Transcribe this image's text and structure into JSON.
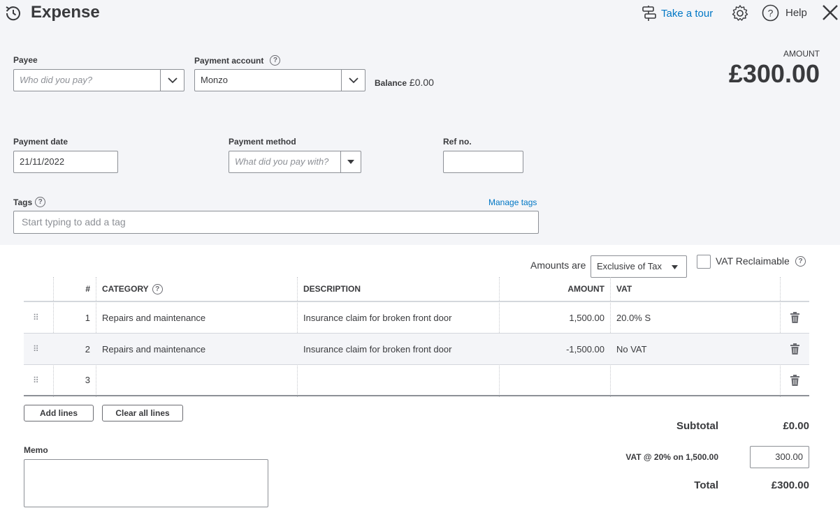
{
  "header": {
    "title": "Expense",
    "tour_label": "Take a tour",
    "help_label": "Help"
  },
  "payee": {
    "label": "Payee",
    "placeholder": "Who did you pay?"
  },
  "payment_account": {
    "label": "Payment account",
    "value": "Monzo",
    "balance_label": "Balance",
    "balance_value": "£0.00"
  },
  "amount": {
    "label": "AMOUNT",
    "value": "£300.00"
  },
  "payment_date": {
    "label": "Payment date",
    "value": "21/11/2022"
  },
  "payment_method": {
    "label": "Payment method",
    "placeholder": "What did you pay with?"
  },
  "ref_no": {
    "label": "Ref no.",
    "value": ""
  },
  "tags": {
    "label": "Tags",
    "manage_label": "Manage tags",
    "placeholder": "Start typing to add a tag"
  },
  "tax_options": {
    "amounts_are_label": "Amounts are",
    "amounts_are_value": "Exclusive of Tax",
    "vat_reclaimable_label": "VAT Reclaimable"
  },
  "table": {
    "headers": {
      "num": "#",
      "category": "CATEGORY",
      "description": "DESCRIPTION",
      "amount": "AMOUNT",
      "vat": "VAT"
    },
    "rows": [
      {
        "num": "1",
        "category": "Repairs and maintenance",
        "description": "Insurance claim for broken front door",
        "amount": "1,500.00",
        "vat": "20.0% S"
      },
      {
        "num": "2",
        "category": "Repairs and maintenance",
        "description": "Insurance claim for broken front door",
        "amount": "-1,500.00",
        "vat": "No VAT"
      },
      {
        "num": "3",
        "category": "",
        "description": "",
        "amount": "",
        "vat": ""
      }
    ]
  },
  "buttons": {
    "add_lines": "Add lines",
    "clear_all_lines": "Clear all lines"
  },
  "memo": {
    "label": "Memo",
    "value": ""
  },
  "totals": {
    "subtotal_label": "Subtotal",
    "subtotal_value": "£0.00",
    "vat_label": "VAT @ 20% on 1,500.00",
    "vat_value": "300.00",
    "total_label": "Total",
    "total_value": "£300.00"
  },
  "colors": {
    "link": "#0077c5",
    "panel_bg": "#f4f5f8",
    "text": "#393a3d"
  }
}
